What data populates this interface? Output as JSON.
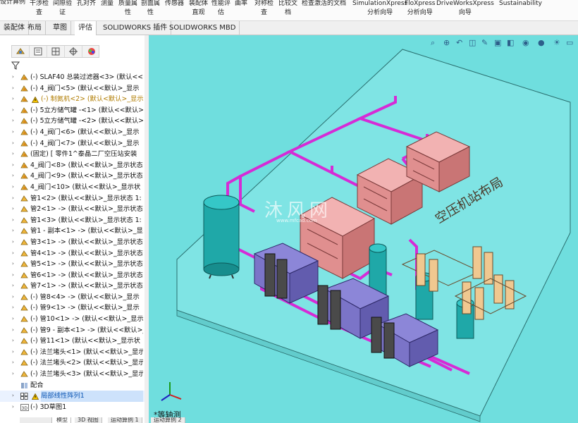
{
  "ribbon": {
    "top_left": "设计算例",
    "buttons": [
      {
        "l1": "干涉检",
        "l2": "查"
      },
      {
        "l1": "间隙验",
        "l2": "证"
      },
      {
        "l1": "孔对齐",
        "l2": ""
      },
      {
        "l1": "测量",
        "l2": ""
      },
      {
        "l1": "质量属",
        "l2": "性"
      },
      {
        "l1": "剖面属",
        "l2": "性"
      },
      {
        "l1": "传感器",
        "l2": ""
      },
      {
        "l1": "装配体",
        "l2": "直观"
      },
      {
        "l1": "性能评",
        "l2": "估"
      },
      {
        "l1": "曲率",
        "l2": ""
      },
      {
        "l1": "对称检",
        "l2": "查"
      },
      {
        "l1": "比较文",
        "l2": "档"
      },
      {
        "l1": "检查激活的文档",
        "l2": ""
      },
      {
        "l1": "SimulationXpress",
        "l2": "分析向导"
      },
      {
        "l1": "FloXpress",
        "l2": "分析向导"
      },
      {
        "l1": "DriveWorksXpress",
        "l2": "向导"
      },
      {
        "l1": "Sustainability",
        "l2": ""
      }
    ]
  },
  "tabs": [
    "装配体",
    "布局",
    "草图",
    "评估",
    "SOLIDWORKS 插件",
    "SOLIDWORKS MBD"
  ],
  "active_tab": "评估",
  "tree_items": [
    {
      "label": "(-) SLAF40 总装过滤器<3> (默认<<默认",
      "icon": "assembly",
      "warn": false
    },
    {
      "label": "(-) 4_阀门<5> (默认<<默认>_显示",
      "icon": "assembly",
      "warn": false
    },
    {
      "label": "(-) 制氮机<2> (默认<默认>_显示",
      "icon": "assembly",
      "warn": true,
      "highlight": true
    },
    {
      "label": "(-) 5立方储气罐 -<1> (默认<<默认>",
      "icon": "assembly",
      "warn": false
    },
    {
      "label": "(-) 5立方储气罐 -<2> (默认<<默认>",
      "icon": "assembly",
      "warn": false
    },
    {
      "label": "(-) 4_阀门<6> (默认<<默认>_显示",
      "icon": "assembly",
      "warn": false
    },
    {
      "label": "(-) 4_阀门<7> (默认<<默认>_显示",
      "icon": "assembly",
      "warn": false
    },
    {
      "label": "(固定) [ 零件1^泰晶二厂空压站安装",
      "icon": "assembly",
      "warn": false
    },
    {
      "label": "4_阀门<8> (默认<<默认>_显示状态",
      "icon": "assembly",
      "warn": false
    },
    {
      "label": "4_阀门<9> (默认<<默认>_显示状态",
      "icon": "assembly",
      "warn": false
    },
    {
      "label": "4_阀门<10> (默认<<默认>_显示状",
      "icon": "assembly",
      "warn": false
    },
    {
      "label": "管1<2> (默认<<默认>_显示状态 1:",
      "icon": "part",
      "warn": false
    },
    {
      "label": "管2<1> -> (默认<<默认>_显示状态 1",
      "icon": "part",
      "warn": false
    },
    {
      "label": "管1<3> (默认<<默认>_显示状态 1:",
      "icon": "part",
      "warn": false
    },
    {
      "label": "管1 - 副本<1> -> (默认<<默认>_显示",
      "icon": "part",
      "warn": false
    },
    {
      "label": "管3<1> -> (默认<<默认>_显示状态 1",
      "icon": "part",
      "warn": false
    },
    {
      "label": "管4<1> -> (默认<<默认>_显示状态 1",
      "icon": "part",
      "warn": false
    },
    {
      "label": "管5<1> -> (默认<<默认>_显示状态",
      "icon": "part",
      "warn": false
    },
    {
      "label": "管6<1> -> (默认<<默认>_显示状态 1",
      "icon": "part",
      "warn": false
    },
    {
      "label": "管7<1> -> (默认<<默认>_显示状态 1",
      "icon": "part",
      "warn": false
    },
    {
      "label": "(-) 管8<4> -> (默认<<默认>_显示",
      "icon": "part",
      "warn": false
    },
    {
      "label": "(-) 管9<1> -> (默认<<默认>_显示",
      "icon": "part",
      "warn": false
    },
    {
      "label": "(-) 管10<1> -> (默认<<默认>_显示",
      "icon": "part",
      "warn": false
    },
    {
      "label": "(-) 管9 - 副本<1> -> (默认<<默认>_显",
      "icon": "part",
      "warn": false
    },
    {
      "label": "(-) 管11<1> (默认<<默认>_显示状",
      "icon": "part",
      "warn": false
    },
    {
      "label": "(-) 法兰堵头<1> (默认<<默认>_显示",
      "icon": "part",
      "warn": false
    },
    {
      "label": "(-) 法兰堵头<2> (默认<<默认>_显示",
      "icon": "part",
      "warn": false
    },
    {
      "label": "(-) 法兰堵头<3> (默认<<默认>_显示",
      "icon": "part",
      "warn": false
    },
    {
      "label": "配合",
      "icon": "mates",
      "warn": false,
      "noarrow": true
    },
    {
      "label": "局部线性阵列1",
      "icon": "pattern",
      "warn": true,
      "selected": true
    },
    {
      "label": "(-) 3D草图1",
      "icon": "sketch",
      "warn": false
    }
  ],
  "viewport": {
    "view_label": "*等轴测",
    "plant_title": "空压机站布局",
    "watermark_text": "沐风网",
    "watermark_sub": "www.mfcad.com"
  },
  "bottom_tabs": [
    "",
    "模型",
    "3D 视图",
    "运动算例 1",
    "运动算例 2"
  ],
  "colors": {
    "viewport_bg": "#6fdede",
    "pipe": "#d62bd6",
    "compressor": "#e89c9c",
    "tank": "#1fa8a8",
    "dryer": "#8c86d8",
    "frame": "#e8c078"
  }
}
